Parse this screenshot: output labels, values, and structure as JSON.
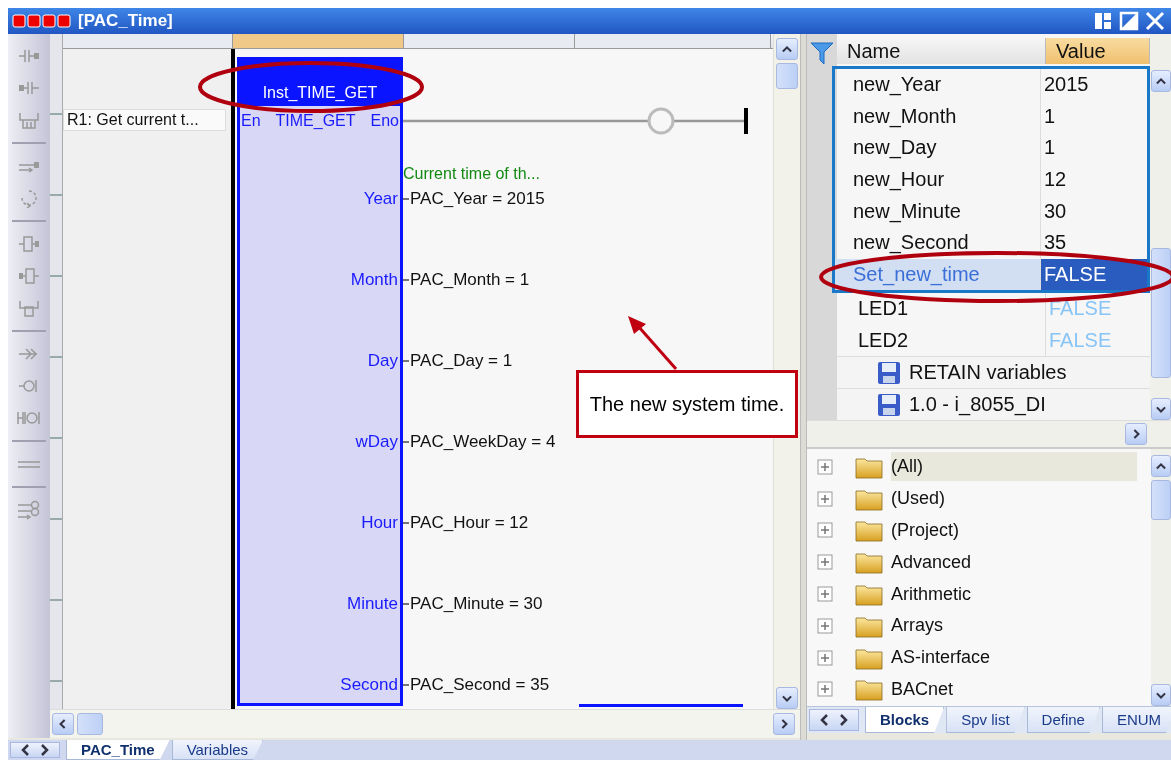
{
  "window": {
    "title": "[PAC_Time]"
  },
  "ladder": {
    "rung_comment": "R1: Get current t...",
    "instance": "Inst_TIME_GET",
    "instance_circled": true,
    "input_pin": "En",
    "block_type": "TIME_GET",
    "output_pin": "Eno",
    "output_comment": "Current time of th...",
    "outputs": [
      {
        "pin": "Year",
        "variable": "PAC_Year = 2015"
      },
      {
        "pin": "Month",
        "variable": "PAC_Month = 1"
      },
      {
        "pin": "Day",
        "variable": "PAC_Day = 1"
      },
      {
        "pin": "wDay",
        "variable": "PAC_WeekDay = 4"
      },
      {
        "pin": "Hour",
        "variable": "PAC_Hour = 12"
      },
      {
        "pin": "Minute",
        "variable": "PAC_Minute = 30"
      },
      {
        "pin": "Second",
        "variable": "PAC_Second = 35"
      }
    ]
  },
  "variables": {
    "columns": [
      "Name",
      "Value"
    ],
    "framed_rows": [
      {
        "name": "new_Year",
        "value": "2015",
        "selected": false,
        "circled": false,
        "dimmed": false
      },
      {
        "name": "new_Month",
        "value": "1",
        "selected": false,
        "circled": false,
        "dimmed": false
      },
      {
        "name": "new_Day",
        "value": "1",
        "selected": false,
        "circled": false,
        "dimmed": false
      },
      {
        "name": "new_Hour",
        "value": "12",
        "selected": false,
        "circled": false,
        "dimmed": false
      },
      {
        "name": "new_Minute",
        "value": "30",
        "selected": false,
        "circled": false,
        "dimmed": false
      },
      {
        "name": "new_Second",
        "value": "35",
        "selected": false,
        "circled": false,
        "dimmed": false
      },
      {
        "name": "Set_new_time",
        "value": "FALSE",
        "selected": true,
        "circled": true,
        "dimmed": false
      }
    ],
    "rows": [
      {
        "name": "LED1",
        "value": "FALSE",
        "selected": false,
        "circled": false,
        "dimmed": true
      },
      {
        "name": "LED2",
        "value": "FALSE",
        "selected": false,
        "circled": false,
        "dimmed": true
      }
    ],
    "groups": [
      {
        "label": "RETAIN variables"
      },
      {
        "label": "1.0 - i_8055_DI"
      }
    ]
  },
  "library": {
    "items": [
      {
        "label": "(All)",
        "selected": true
      },
      {
        "label": "(Used)",
        "selected": false
      },
      {
        "label": "(Project)",
        "selected": false
      },
      {
        "label": "Advanced",
        "selected": false
      },
      {
        "label": "Arithmetic",
        "selected": false
      },
      {
        "label": "Arrays",
        "selected": false
      },
      {
        "label": "AS-interface",
        "selected": false
      },
      {
        "label": "BACnet",
        "selected": false
      }
    ],
    "tabs": [
      {
        "label": "Blocks",
        "selected": true
      },
      {
        "label": "Spv list",
        "selected": false
      },
      {
        "label": "Define",
        "selected": false
      },
      {
        "label": "ENUM",
        "selected": false
      }
    ]
  },
  "editor_tabs": [
    {
      "label": "PAC_Time",
      "selected": true
    },
    {
      "label": "Variables",
      "selected": false
    }
  ],
  "callout": {
    "text": "The new system time."
  }
}
